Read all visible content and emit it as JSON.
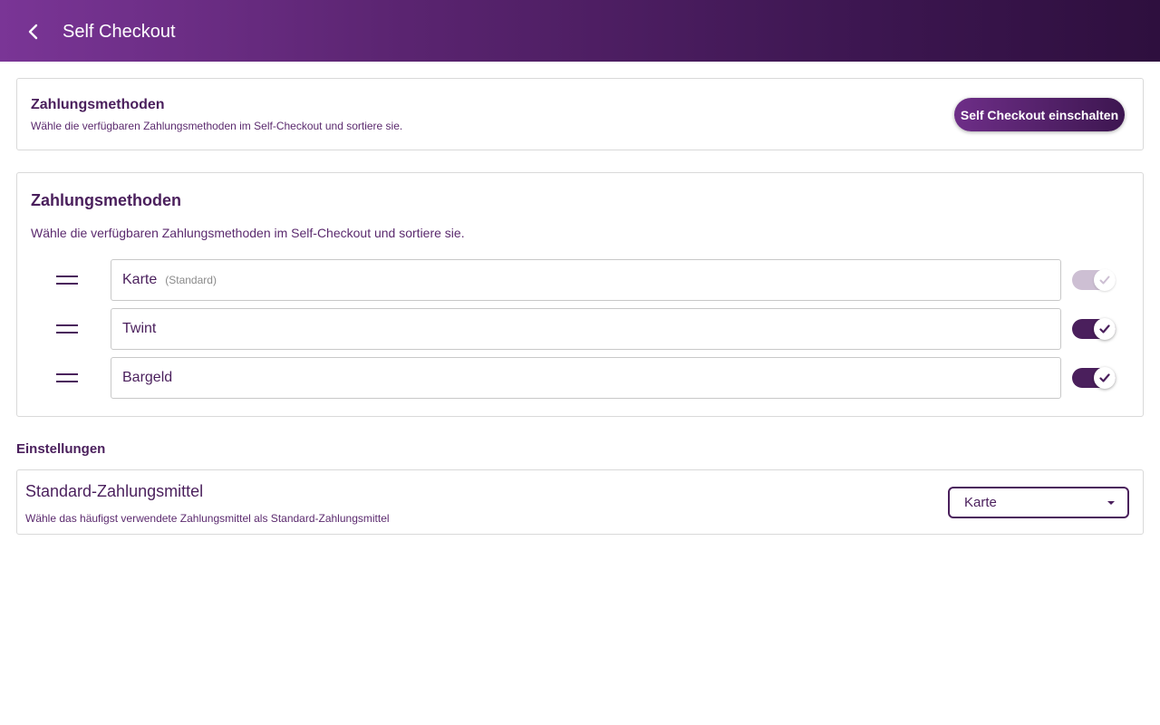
{
  "appbar": {
    "title": "Self Checkout",
    "back_icon": "chevron-left-icon"
  },
  "header_card": {
    "title": "Zahlungsmethoden",
    "subtitle": "Wähle die verfügbaren Zahlungsmethoden im Self-Checkout und sortiere sie.",
    "enable_button_label": "Self Checkout einschalten"
  },
  "methods_card": {
    "title": "Zahlungsmethoden",
    "subtitle": "Wähle die verfügbaren Zahlungsmethoden im Self-Checkout und sortiere sie.",
    "items": [
      {
        "name": "Karte",
        "tag": "(Standard)",
        "enabled": true,
        "locked": true
      },
      {
        "name": "Twint",
        "tag": "",
        "enabled": true,
        "locked": false
      },
      {
        "name": "Bargeld",
        "tag": "",
        "enabled": true,
        "locked": false
      }
    ]
  },
  "settings": {
    "section_title": "Einstellungen",
    "default_payment": {
      "title": "Standard-Zahlungsmittel",
      "subtitle": "Wähle das häufigst verwendete Zahlungsmittel als Standard-Zahlungsmittel",
      "selected": "Karte"
    }
  },
  "colors": {
    "brand": "#4a1f5c",
    "gradient_start": "#7a3596",
    "gradient_end": "#2e0f3e",
    "toggle_disabled": "#cdbfd3"
  }
}
